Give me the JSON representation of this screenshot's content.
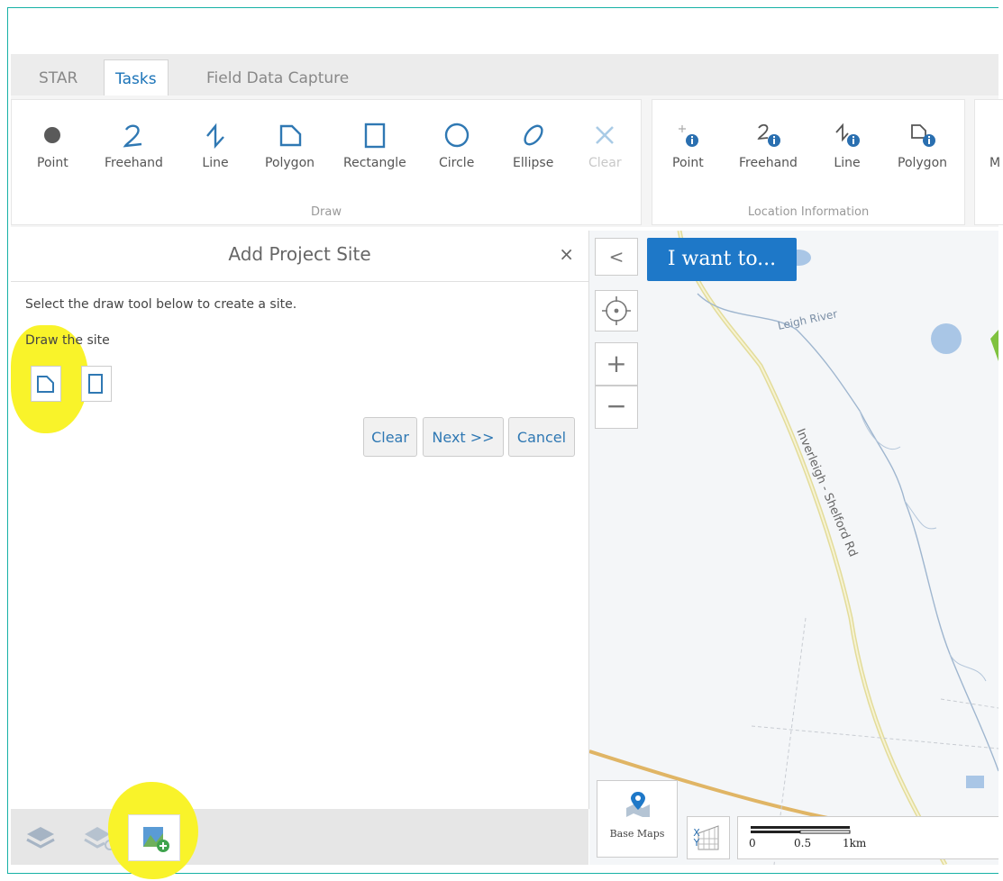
{
  "tabs": [
    {
      "label": "STAR",
      "active": false
    },
    {
      "label": "Tasks",
      "active": true
    },
    {
      "label": "Field Data Capture",
      "active": false
    }
  ],
  "ribbon": {
    "draw_group": {
      "title": "Draw",
      "buttons": [
        {
          "label": "Point",
          "icon": "point-icon"
        },
        {
          "label": "Freehand",
          "icon": "freehand-icon"
        },
        {
          "label": "Line",
          "icon": "line-icon"
        },
        {
          "label": "Polygon",
          "icon": "polygon-icon"
        },
        {
          "label": "Rectangle",
          "icon": "rectangle-icon"
        },
        {
          "label": "Circle",
          "icon": "circle-icon"
        },
        {
          "label": "Ellipse",
          "icon": "ellipse-icon"
        },
        {
          "label": "Clear",
          "icon": "clear-icon",
          "disabled": true
        }
      ]
    },
    "location_group": {
      "title": "Location Information",
      "buttons": [
        {
          "label": "Point",
          "icon": "point-info-icon"
        },
        {
          "label": "Freehand",
          "icon": "freehand-info-icon"
        },
        {
          "label": "Line",
          "icon": "line-info-icon"
        },
        {
          "label": "Polygon",
          "icon": "polygon-info-icon"
        }
      ],
      "partial_label": "M"
    }
  },
  "panel": {
    "title": "Add Project Site",
    "close": "×",
    "instruction": "Select the draw tool below to create a site.",
    "draw_label": "Draw the site",
    "buttons": {
      "clear": "Clear",
      "next": "Next >>",
      "cancel": "Cancel"
    }
  },
  "map": {
    "i_want": "I want to...",
    "collapse": "<",
    "zoom_in": "+",
    "zoom_out": "−",
    "river_label": "Leigh River",
    "road_label": "Inverleigh - Shelford Rd",
    "basemaps_label": "Base Maps",
    "xy_label": "XY",
    "scale": {
      "t0": "0",
      "t1": "0.5",
      "t2": "1km"
    }
  },
  "colors": {
    "accent": "#1e78c8",
    "highlight": "#f9f32a",
    "frame": "#17b1a6"
  }
}
